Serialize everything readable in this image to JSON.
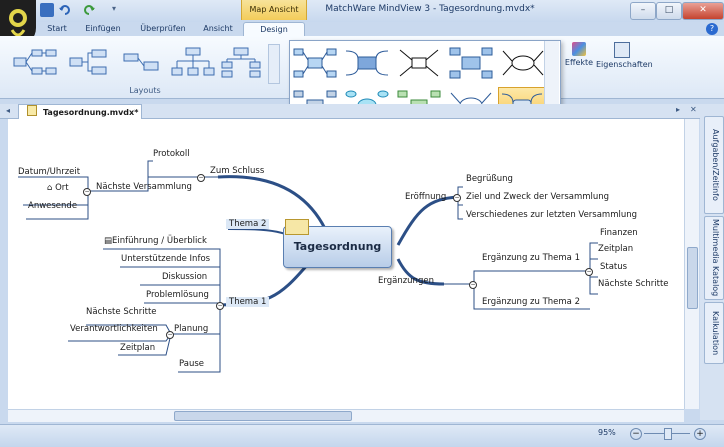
{
  "window": {
    "title": "MatchWare MindView 3 - Tagesordnung.mvdx*",
    "context_tab_group": "Map Ansicht"
  },
  "ribbon": {
    "tabs": [
      "Start",
      "Einfügen",
      "Überprüfen",
      "Ansicht",
      "Design"
    ],
    "layouts_label": "Layouts",
    "effects_label": "Effekte",
    "properties_label": "Eigenschaften"
  },
  "document": {
    "tab_title": "Tagesordnung.mvdx*"
  },
  "sidepanel": {
    "tabs": [
      "Aufgaben/Zeitinfo",
      "Multimedia Katalog",
      "Kalkulation"
    ]
  },
  "status": {
    "zoom": "95%"
  },
  "mindmap": {
    "central": "Tagesordnung",
    "zum_schluss": "Zum Schluss",
    "protokoll": "Protokoll",
    "naechste_versammlung": "Nächste Versammlung",
    "datum": "Datum/Uhrzeit",
    "ort": "Ort",
    "anwesende": "Anwesende",
    "thema2": "Thema 2",
    "thema1": "Thema 1",
    "einfuehrung": "Einführung / Überblick",
    "unterstuetzende": "Unterstützende Infos",
    "diskussion": "Diskussion",
    "problemloesung": "Problemlösung",
    "planung": "Planung",
    "naechste_schritte_l": "Nächste Schritte",
    "verantwortlichkeiten": "Verantwortlichkeiten",
    "zeitplan_l": "Zeitplan",
    "pause": "Pause",
    "eroeffnung": "Eröffnung",
    "begruessung": "Begrüßung",
    "ziel": "Ziel und Zweck der Versammlung",
    "verschiedenes": "Verschiedenes zur letzten Versammlung",
    "ergaenzungen": "Ergänzungen",
    "ergaenzung1": "Ergänzung zu Thema 1",
    "ergaenzung2": "Ergänzung zu Thema 2",
    "finanzen": "Finanzen",
    "zeitplan_r": "Zeitplan",
    "status_node": "Status",
    "naechste_schritte_r": "Nächste Schritte"
  }
}
